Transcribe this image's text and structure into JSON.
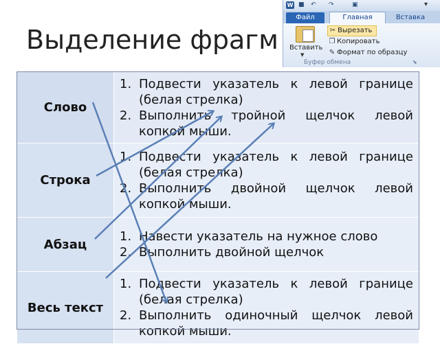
{
  "slide": {
    "title": "Выделение фрагм"
  },
  "ribbon": {
    "tabs": [
      "Файл",
      "Главная",
      "Вставка"
    ],
    "paste_label": "Вставить",
    "commands": [
      "Вырезать",
      "Копировать",
      "Формат по образцу"
    ],
    "group_label": "Буфер обмена",
    "icons": [
      "word-logo-icon",
      "save-icon",
      "undo-icon",
      "redo-icon",
      "print-preview-icon",
      "customize-qat-icon",
      "paste-icon",
      "scissors-icon",
      "copy-icon",
      "format-painter-icon",
      "dialog-launcher-icon"
    ]
  },
  "table": {
    "rows": [
      {
        "term": "Слово",
        "steps": [
          "Подвести указатель к левой границе (белая стрелка)",
          "Выполнить тройной щелчок левой копкой мыши."
        ]
      },
      {
        "term": "Строка",
        "steps": [
          "Подвести указатель к левой границе (белая стрелка)",
          "Выполнить двойной щелчок левой копкой мыши."
        ]
      },
      {
        "term": "Абзац",
        "steps": [
          "Навести указатель на нужное слово",
          "Выполнить двойной щелчок"
        ]
      },
      {
        "term": "Весь текст",
        "steps": [
          "Подвести указатель к левой границе (белая стрелка)",
          "Выполнить одиночный щелчок левой копкой мыши."
        ]
      }
    ],
    "numbers": [
      "1.",
      "2."
    ]
  },
  "colors": {
    "arrow": "#5a7fb5",
    "term_cell": "#d6e1f1",
    "desc_cell": "#e7eef8",
    "border": "#7f8aa6"
  }
}
